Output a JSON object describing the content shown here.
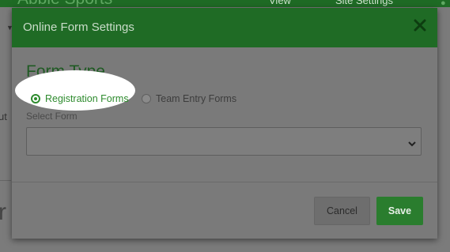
{
  "app": {
    "brand": "Abbie Sports",
    "nav": {
      "view_label": "View",
      "settings_label": "Site Settings"
    },
    "peek_text_1": "ut",
    "peek_text_2": "r"
  },
  "modal": {
    "title": "Online Form Settings",
    "section_heading": "Form Type",
    "radio_options": [
      {
        "label": "Registration Forms",
        "checked": true
      },
      {
        "label": "Team Entry Forms",
        "checked": false
      }
    ],
    "select": {
      "label": "Select Form",
      "value": ""
    },
    "buttons": {
      "cancel_label": "Cancel",
      "save_label": "Save"
    }
  },
  "colors": {
    "header_green": "#1f6b25",
    "accent_green": "#2e8b2e",
    "save_button": "#2a7d2e",
    "overlay_gray": "#7b7b7b",
    "highlight": "#ffffff"
  },
  "icons": {
    "close": "close-icon",
    "chevron": "chevron-down-icon",
    "view": "search-icon",
    "settings": "gear-icon",
    "user": "user-icon"
  }
}
